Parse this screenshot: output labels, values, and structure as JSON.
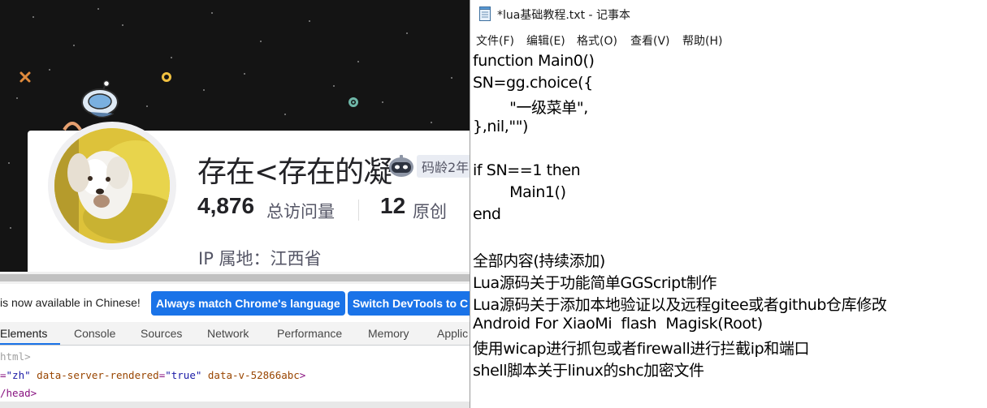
{
  "browser_page": {
    "profile": {
      "name": "存在<存在的凝",
      "badge_text": "码龄2年",
      "visits_count": "4,876",
      "visits_label": "总访问量",
      "original_count": "12",
      "original_label": "原创",
      "ip_location": "IP 属地：江西省"
    }
  },
  "devtools": {
    "infobar_text": "is now available in Chinese!",
    "buttons": {
      "match_language": "Always match Chrome's language",
      "switch_language": "Switch DevTools to C"
    },
    "tabs": [
      "Elements",
      "Console",
      "Sources",
      "Network",
      "Performance",
      "Memory",
      "Applic"
    ],
    "active_tab": "Elements",
    "source": {
      "line1": "html>",
      "line2_lang_attr": "=",
      "line2_lang_val": "\"zh\"",
      "line2_attr1": "data-server-rendered",
      "line2_val1": "\"true\"",
      "line2_attr2": "data-v-52866abc",
      "line2_close": ">",
      "line3": "/head>"
    }
  },
  "notepad": {
    "title": "*lua基础教程.txt - 记事本",
    "menu": [
      "文件(F)",
      "编辑(E)",
      "格式(O)",
      "查看(V)",
      "帮助(H)"
    ],
    "lines": [
      "function Main0()",
      "SN=gg.choice({",
      "        \"一级菜单\",",
      "},nil,\"\")",
      "",
      "if SN==1 then",
      "        Main1()",
      "end",
      "",
      "全部内容(持续添加)",
      "Lua源码关于功能简单GGScript制作",
      "Lua源码关于添加本地验证以及远程gitee或者github仓库修改",
      "Android For XiaoMi  flash  Magisk(Root)",
      "使用wicap进行抓包或者firewall进行拦截ip和端口",
      "shell脚本关于linux的shc加密文件"
    ]
  }
}
